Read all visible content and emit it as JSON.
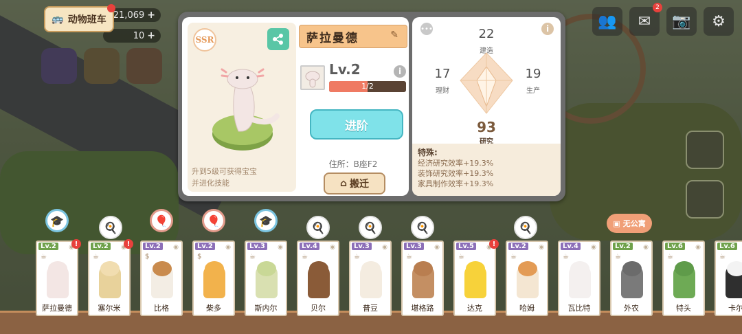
{
  "hud": {
    "bus_label": "动物班车",
    "coins": "21,069",
    "gems": "10",
    "plus": "+",
    "top_badge": "2"
  },
  "detail": {
    "rarity": "SSR",
    "hint_line1": "升到5级可获得宝宝",
    "hint_line2": "并进化技能",
    "name": "萨拉曼德",
    "edit_icon": "✎",
    "level": "Lv.2",
    "xp_text": "1/2",
    "xp_progress": 0.5,
    "advance_label": "进阶",
    "residence": "住所：B座F2",
    "move_label": "搬迁"
  },
  "stats": {
    "build_value": "22",
    "build_label": "建造",
    "finance_value": "17",
    "finance_label": "理财",
    "production_value": "19",
    "production_label": "生产",
    "research_value": "93",
    "research_label": "研究",
    "special_title": "特殊:",
    "special_lines": [
      "经济研究效率+19.3%",
      "装饰研究效率+19.3%",
      "家具制作效率+19.3%"
    ]
  },
  "homeless_tag": "无公寓",
  "cards": [
    {
      "level": "Lv.2",
      "lvcolor": "green",
      "work": "☕",
      "name": "萨拉曼德",
      "alert": "!",
      "head": "#f3e6e4",
      "body": "#f3e6e4"
    },
    {
      "level": "Lv.2",
      "lvcolor": "green",
      "work": "☕",
      "name": "塞尔米",
      "alert": "!",
      "head": "#f1ddb0",
      "body": "#e8d29b"
    },
    {
      "level": "Lv.2",
      "lvcolor": "purple",
      "work": "$",
      "name": "比格",
      "alert": "",
      "head": "#c98b4e",
      "body": "#f3ede4"
    },
    {
      "level": "Lv.2",
      "lvcolor": "purple",
      "work": "$",
      "name": "柴多",
      "alert": "",
      "head": "#f2b24c",
      "body": "#f2b24c"
    },
    {
      "level": "Lv.3",
      "lvcolor": "purple",
      "work": "☕",
      "name": "斯内尔",
      "alert": "",
      "head": "#c9d896",
      "body": "#d9e0b1"
    },
    {
      "level": "Lv.4",
      "lvcolor": "purple",
      "work": "☕",
      "name": "贝尔",
      "alert": "",
      "head": "#8a5b38",
      "body": "#8a5b38"
    },
    {
      "level": "Lv.3",
      "lvcolor": "purple",
      "work": "☕",
      "name": "普豆",
      "alert": "",
      "head": "#f4ece0",
      "body": "#f4ece0"
    },
    {
      "level": "Lv.3",
      "lvcolor": "purple",
      "work": "☕",
      "name": "堪格路",
      "alert": "",
      "head": "#b97e50",
      "body": "#c48f63"
    },
    {
      "level": "Lv.5",
      "lvcolor": "purple",
      "work": "☕",
      "name": "达克",
      "alert": "!",
      "head": "#f7d23a",
      "body": "#f7d23a"
    },
    {
      "level": "Lv.2",
      "lvcolor": "purple",
      "work": "☕",
      "name": "哈姆",
      "alert": "",
      "head": "#e39b55",
      "body": "#f4e6d2"
    },
    {
      "level": "Lv.4",
      "lvcolor": "purple",
      "work": "☕",
      "name": "瓦比特",
      "alert": "",
      "head": "#f4f0ef",
      "body": "#f4f0ef"
    },
    {
      "level": "Lv.2",
      "lvcolor": "green",
      "work": "☕",
      "name": "外农",
      "alert": "",
      "head": "#6b6b6b",
      "body": "#7a7a7a"
    },
    {
      "level": "Lv.6",
      "lvcolor": "green",
      "work": "☕",
      "name": "特头",
      "alert": "",
      "head": "#5f9b4a",
      "body": "#6eaa55"
    },
    {
      "level": "Lv.6",
      "lvcolor": "green",
      "work": "☕",
      "name": "卡尔",
      "alert": "",
      "head": "#f3f3f3",
      "body": "#2f2f2f"
    }
  ],
  "bubbles": [
    "🎓",
    "🍳",
    "🎈",
    "🎈",
    "🎓",
    "🍳",
    "🍳",
    "🍳",
    "🍳"
  ]
}
